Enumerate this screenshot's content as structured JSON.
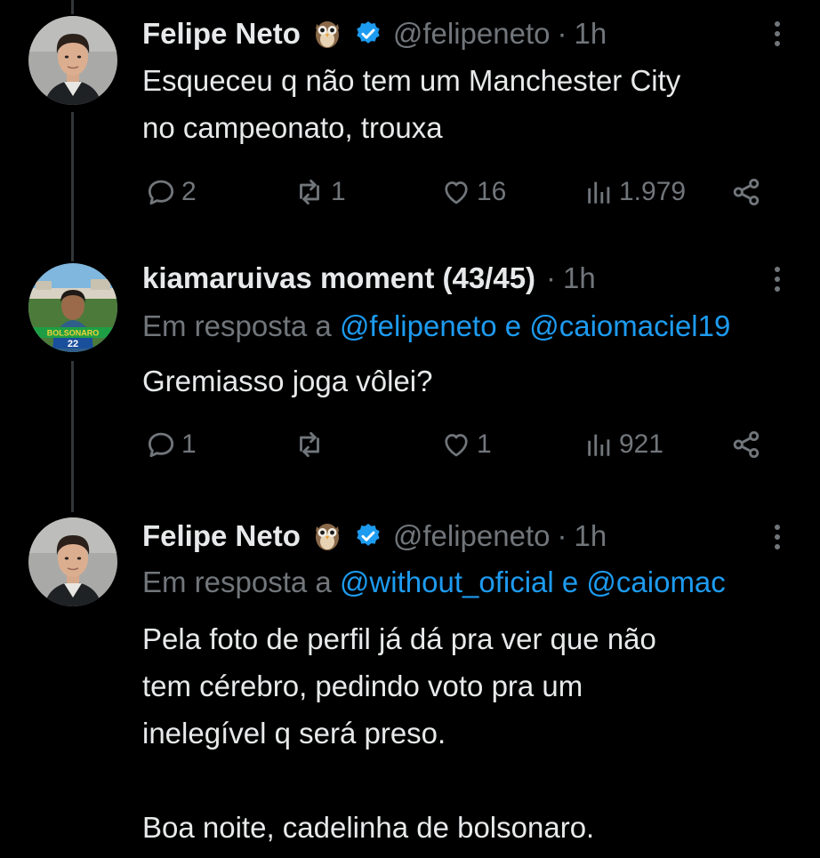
{
  "tweets": [
    {
      "name": "Felipe Neto",
      "handle": "@felipeneto",
      "dot": "·",
      "time": "1h",
      "text": "Esqueceu q não tem um Manchester City\nno campeonato, trouxa",
      "replies": "2",
      "retweets": "1",
      "likes": "16",
      "views": "1.979"
    },
    {
      "name": "kiamaruivas moment (43/45)",
      "dot": "·",
      "time": "1h",
      "reply_prefix": "Em resposta a ",
      "reply_users": "@felipeneto e @caiomaciel19",
      "avatar_banner": "BOLSONARO",
      "avatar_number": "22",
      "text": "Gremiasso joga vôlei?",
      "replies": "1",
      "retweets": "",
      "likes": "1",
      "views": "921"
    },
    {
      "name": "Felipe Neto",
      "handle": "@felipeneto",
      "dot": "·",
      "time": "1h",
      "reply_prefix": "Em resposta a ",
      "reply_users": "@without_oficial e @caiomac",
      "text": "Pela foto de perfil já dá pra ver que não\ntem cérebro, pedindo voto pra um\ninelegível q será preso.\n\nBoa noite, cadelinha de bolsonaro."
    }
  ],
  "icons": {
    "reply": "reply-icon",
    "retweet": "retweet-icon",
    "like": "heart-icon",
    "views": "views-icon",
    "share": "share-icon",
    "more": "more-icon",
    "verified": "verified-badge-icon",
    "owl": "owl-emoji-icon"
  },
  "colors": {
    "background": "#000000",
    "text": "#e7e9ea",
    "muted": "#71767b",
    "link": "#1d9bf0",
    "verified": "#1d9bf0"
  }
}
